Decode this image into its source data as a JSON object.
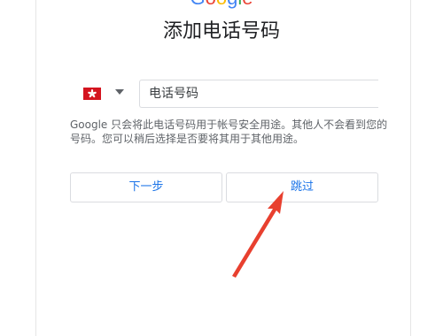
{
  "logo": {
    "text": "Google",
    "colors": [
      "#4285F4",
      "#EA4335",
      "#FBBC05",
      "#4285F4",
      "#34A853",
      "#EA4335"
    ]
  },
  "title": "添加电话号码",
  "country": {
    "flag_icon": "hong-kong-flag-icon",
    "flag_color": "#d4141f"
  },
  "phone": {
    "placeholder": "电话号码",
    "value": ""
  },
  "note": "Google 只会将此电话号码用于帐号安全用途。其他人不会看到您的号码。您可以稍后选择是否要将其用于其他用途。",
  "buttons": {
    "next_label": "下一步",
    "skip_label": "跳过"
  },
  "annotation": {
    "arrow_color": "#e8402f"
  }
}
